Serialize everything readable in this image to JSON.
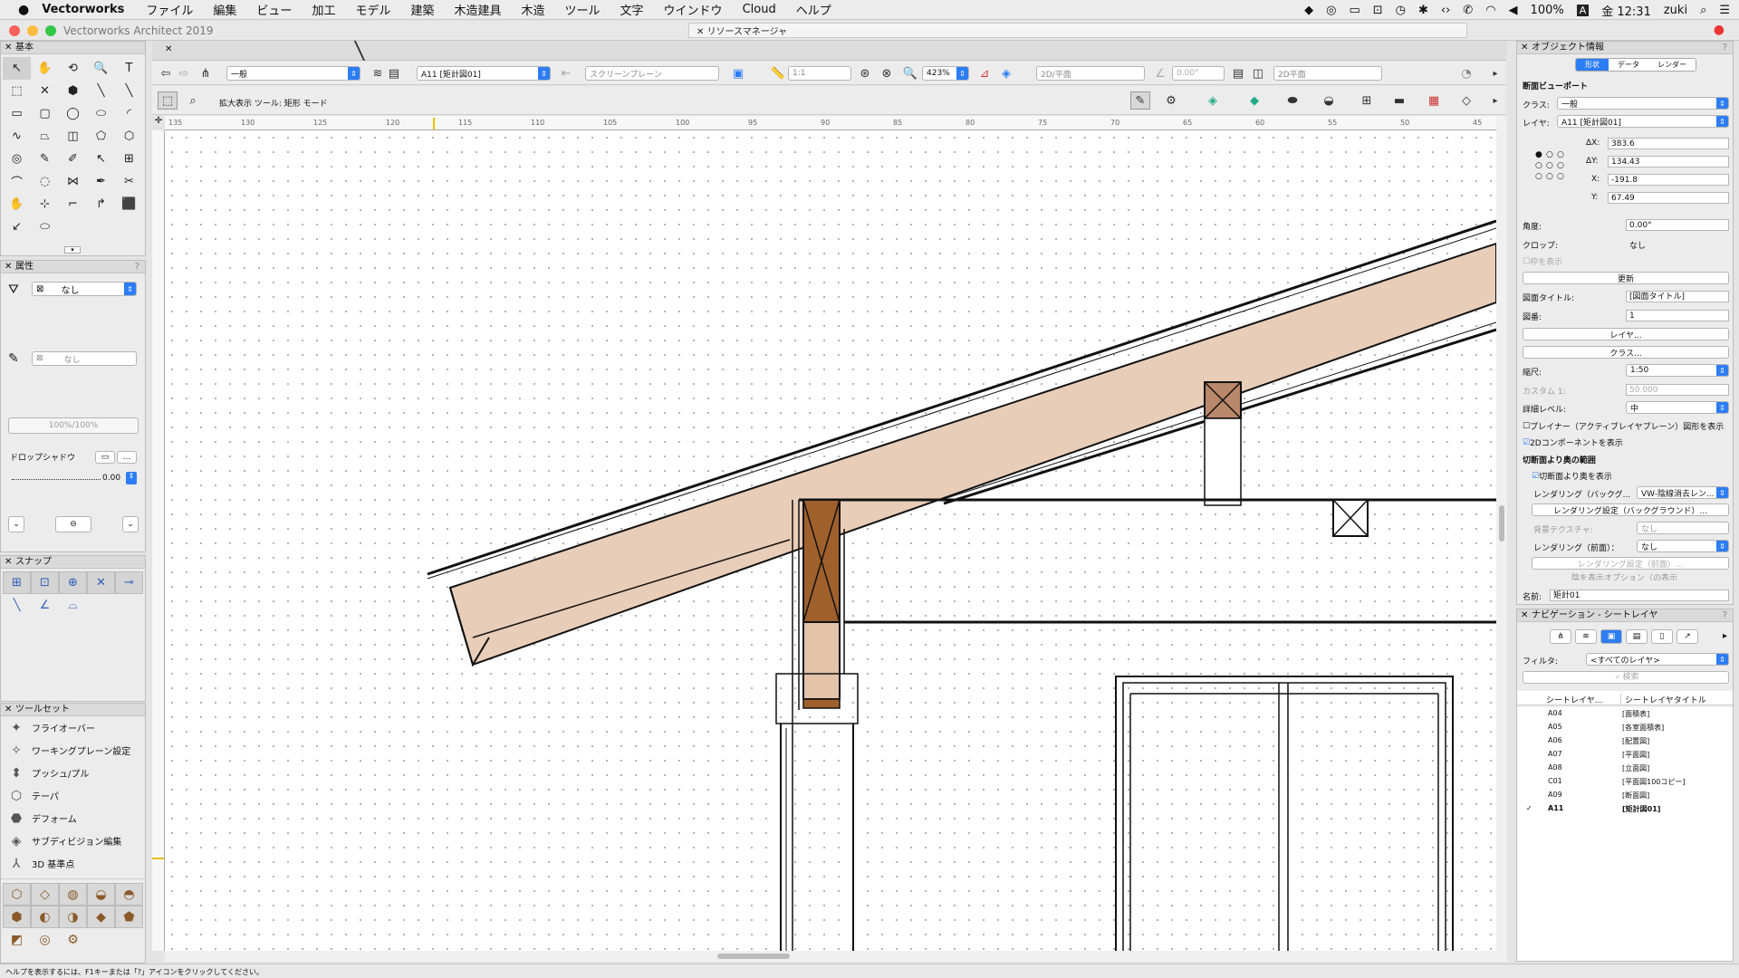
{
  "menubar": {
    "app": "Vectorworks",
    "items": [
      "ファイル",
      "編集",
      "ビュー",
      "加工",
      "モデル",
      "建築",
      "木造建具",
      "木造",
      "ツール",
      "文字",
      "ウインドウ",
      "Cloud",
      "ヘルプ"
    ],
    "battery": "100%",
    "clock": "金 12:31",
    "user": "zuki"
  },
  "window": {
    "title": "Vectorworks Architect 2019",
    "resource_manager": "リソースマネージャ"
  },
  "toolbar": {
    "class_value": "一般",
    "layer_value": "A11 [矩計図01]",
    "plane_value": "スクリーンプレーン",
    "scale_value": "1:1",
    "zoom_value": "423%",
    "view_value": "2D/平面",
    "angle_value": "0.00°",
    "projection_value": "2D平面"
  },
  "modebar": {
    "text": "拡大表示 ツール: 矩形 モード"
  },
  "ruler": {
    "labels": [
      "135",
      "130",
      "125",
      "120",
      "115",
      "110",
      "105",
      "100",
      "95",
      "90",
      "85",
      "80",
      "75",
      "70",
      "65",
      "60",
      "55",
      "50",
      "45"
    ]
  },
  "basic_panel": {
    "title": "基本",
    "tools": [
      "↖",
      "✋",
      "⟲",
      "🔍",
      "T",
      "⬚",
      "✕",
      "⬢",
      "╲",
      "╲",
      "▭",
      "▢",
      "◯",
      "⬭",
      "◜",
      "∿",
      "⏢",
      "◫",
      "⬠",
      "⬡",
      "◎",
      "✎",
      "✐",
      "↖",
      "⊞",
      "⌒",
      "◌",
      "⋈",
      "✒",
      "✂",
      "✋",
      "⊹",
      "⌐",
      "↱",
      "⬛",
      "↙",
      "⬭"
    ]
  },
  "attr_panel": {
    "title": "属性",
    "fill_value": "なし",
    "pen_value": "なし",
    "opacity": "100%/100%",
    "dropshadow_label": "ドロップシャドウ",
    "line_value": "0.00"
  },
  "snap_panel": {
    "title": "スナップ",
    "icons": [
      "⊞",
      "⊡",
      "⊕",
      "✕",
      "⊸",
      "╲",
      "∠",
      "⌓"
    ]
  },
  "toolset_panel": {
    "title": "ツールセット",
    "items": [
      {
        "icon": "✦",
        "label": "フライオーバー"
      },
      {
        "icon": "✧",
        "label": "ワーキングプレーン設定"
      },
      {
        "icon": "⬍",
        "label": "プッシュ/プル"
      },
      {
        "icon": "⬡",
        "label": "テーパ"
      },
      {
        "icon": "⬣",
        "label": "デフォーム"
      },
      {
        "icon": "◈",
        "label": "サブディビジョン編集"
      },
      {
        "icon": "⅄",
        "label": "3D 基準点"
      }
    ],
    "icons_grid": [
      "⬡",
      "◇",
      "◍",
      "◒",
      "◓",
      "⬢",
      "◐",
      "◑",
      "◆",
      "⬟",
      "◩",
      "◎",
      "⚙"
    ]
  },
  "oip": {
    "title": "オブジェクト情報",
    "tabs": [
      "形状",
      "データ",
      "レンダー"
    ],
    "section": "断面ビューポート",
    "class_label": "クラス:",
    "class_value": "一般",
    "layer_label": "レイヤ:",
    "layer_value": "A11 [矩計図01]",
    "dx_label": "ΔX:",
    "dx": "383.6",
    "dy_label": "ΔY:",
    "dy": "134.43",
    "x_label": "X:",
    "x": "-191.8",
    "y_label": "Y:",
    "y": "67.49",
    "angle_label": "角度:",
    "angle": "0.00°",
    "crop_label": "クロップ:",
    "crop": "なし",
    "show_crop": "枠を表示",
    "update": "更新",
    "drawing_title_label": "図面タイトル:",
    "drawing_title": "[図面タイトル]",
    "drawing_no_label": "図番:",
    "drawing_no": "1",
    "layer_btn": "レイヤ...",
    "class_btn": "クラス...",
    "scale_label": "縮尺:",
    "scale": "1:50",
    "custom_label": "カスタム 1:",
    "custom": "50.000",
    "detail_label": "詳細レベル:",
    "detail": "中",
    "planar_label": "プレイナー（アクティブレイヤプレーン）図形を表示",
    "comp2d_label": "2Dコンポーネントを表示",
    "beyond_section": "切断面より奥の範囲",
    "beyond_show": "切断面より奥を表示",
    "render_bg_label": "レンダリング（バックグ...",
    "render_bg": "VW-陰線消去レン...",
    "render_bg_settings": "レンダリング設定（バックグラウンド）...",
    "bg_texture_label": "背景テクスチャ:",
    "bg_texture": "なし",
    "render_fg_label": "レンダリング（前面）：",
    "render_fg": "なし",
    "render_fg_settings": "レンダリング設定（前面）...",
    "more_label": "陰を表示オプション（の表示",
    "name_label": "名前:",
    "name_value": "矩計01"
  },
  "nav": {
    "title": "ナビゲーション - シートレイヤ",
    "filter_label": "フィルタ:",
    "filter_value": "<すべてのレイヤ>",
    "search_placeholder": "検索",
    "col1": "シートレイヤ...",
    "col2": "シートレイヤタイトル",
    "rows": [
      {
        "id": "A04",
        "title": "[面積表]"
      },
      {
        "id": "A05",
        "title": "[各室面積表]"
      },
      {
        "id": "A06",
        "title": "[配置図]"
      },
      {
        "id": "A07",
        "title": "[平面図]"
      },
      {
        "id": "A08",
        "title": "[立面図]"
      },
      {
        "id": "C01",
        "title": "[平面図100コピー]"
      },
      {
        "id": "A09",
        "title": "[断面図]"
      },
      {
        "id": "A11",
        "title": "[矩計図01]"
      }
    ],
    "checked": "✓"
  },
  "status": {
    "text": "ヘルプを表示するには、F1キーまたは「?」アイコンをクリックしてください。"
  }
}
